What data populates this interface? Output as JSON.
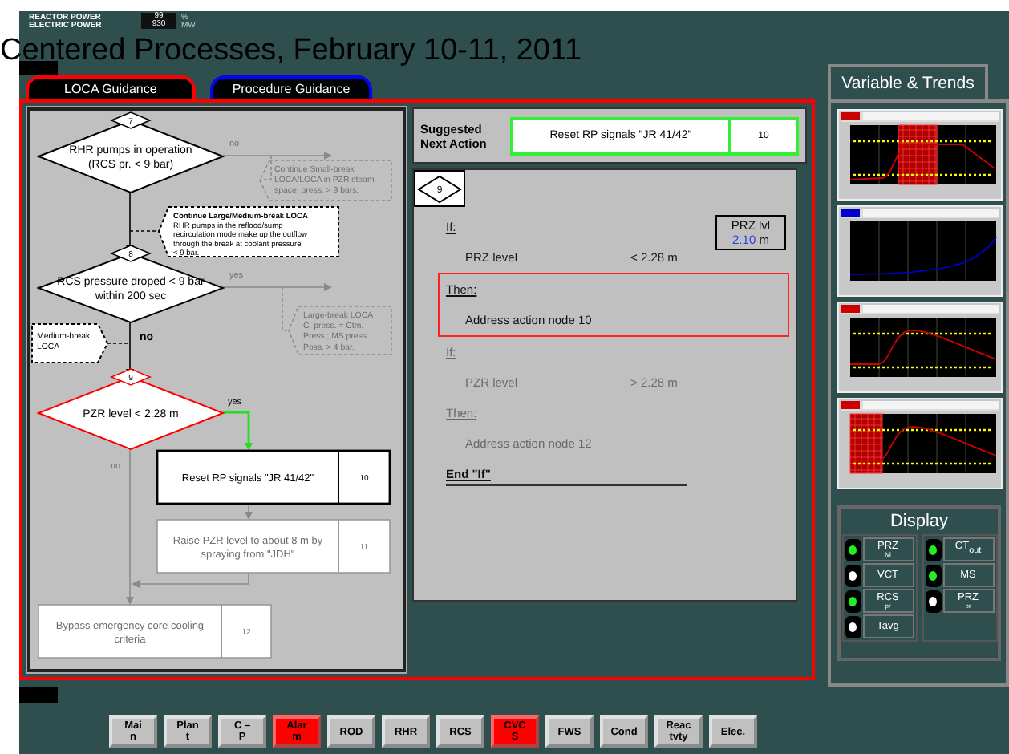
{
  "header": {
    "title": "Centered Processes, February 10-11, 2011",
    "readouts": [
      {
        "label": "REACTOR POWER",
        "value": "99",
        "unit": "%"
      },
      {
        "label": "ELECTRIC POWER",
        "value": "930",
        "unit": "MW"
      }
    ]
  },
  "tabs": [
    {
      "label": "LOCA Guidance",
      "color": "#ff0000",
      "selected": true
    },
    {
      "label": "Procedure Guidance",
      "color": "#0000ff",
      "selected": false
    }
  ],
  "flowchart": {
    "nodes": [
      {
        "kind": "decision",
        "number": "7",
        "highlighted": false,
        "dimmed": false,
        "lines": [
          "RHR pumps in operation",
          "(RCS pr. < 9 bar)"
        ]
      },
      {
        "kind": "note",
        "highlighted": false,
        "dimmed": true,
        "lines": [
          "Continue Small-break",
          "LOCA/LOCA in PZR steam",
          "space; press. > 9 bars."
        ]
      },
      {
        "kind": "note",
        "highlighted": false,
        "dimmed": false,
        "title": "Continue Large/Medium-break LOCA",
        "lines": [
          "RHR pumps in the reflood/sump",
          "recirculation mode make up the outflow",
          "through the break at coolant pressure",
          "< 9 bar."
        ]
      },
      {
        "kind": "decision",
        "number": "8",
        "highlighted": false,
        "dimmed": false,
        "lines": [
          "RCS pressure droped < 9 bar",
          "within 200 sec"
        ]
      },
      {
        "kind": "note",
        "highlighted": false,
        "dimmed": false,
        "lines": [
          "Medium-break",
          "LOCA"
        ]
      },
      {
        "kind": "note",
        "highlighted": false,
        "dimmed": true,
        "lines": [
          "Large-break LOCA",
          "C. press. = Ctm.",
          "Press.; MS press.",
          "Poss. > 4 bar."
        ]
      },
      {
        "kind": "decision",
        "number": "9",
        "highlighted": true,
        "dimmed": false,
        "lines": [
          "PZR level < 2.28 m"
        ]
      },
      {
        "kind": "action",
        "number": "10",
        "highlighted": true,
        "dimmed": false,
        "lines": [
          "Reset RP signals \"JR 41/42\""
        ]
      },
      {
        "kind": "action",
        "number": "11",
        "highlighted": false,
        "dimmed": true,
        "lines": [
          "Raise PZR level to about 8 m by",
          "spraying from \"JDH\""
        ]
      },
      {
        "kind": "action",
        "number": "12",
        "highlighted": false,
        "dimmed": true,
        "lines": [
          "Bypass emergency core cooling",
          "criteria"
        ]
      }
    ],
    "edges": [
      {
        "taken": false,
        "dimmed": true,
        "label": "no"
      },
      {
        "taken": false,
        "dimmed": false
      },
      {
        "taken": false,
        "dimmed": true,
        "label": "yes"
      },
      {
        "taken": false,
        "dimmed": false,
        "label": "no"
      },
      {
        "taken": true,
        "dimmed": false,
        "label": "yes"
      },
      {
        "taken": false,
        "dimmed": true,
        "label": "no"
      },
      {
        "taken": false,
        "dimmed": true
      },
      {
        "taken": false,
        "dimmed": true
      }
    ]
  },
  "suggestion": {
    "title": "Suggested Next Action",
    "action": "Reset RP signals \"JR 41/42\"",
    "number": "10"
  },
  "logic": {
    "node": "9",
    "reading": {
      "label": "PRZ lvl",
      "value": "2.10",
      "unit": "m"
    },
    "blocks": [
      {
        "kind": "if",
        "active": true,
        "label": "If:",
        "subject": "PRZ level",
        "condition": "< 2.28 m"
      },
      {
        "kind": "then",
        "active": true,
        "highlighted": true,
        "label": "Then:",
        "action": "Address action node 10"
      },
      {
        "kind": "if",
        "active": false,
        "label": "If:",
        "subject": "PZR level",
        "condition": "> 2.28 m"
      },
      {
        "kind": "then",
        "active": false,
        "highlighted": false,
        "label": "Then:",
        "action": "Address action node 12"
      }
    ],
    "end": "End \"If\""
  },
  "trends_tab": "Variable & Trends",
  "trends": [
    {
      "kind": "plateau",
      "color": "#cc0000",
      "limits": true,
      "alarm": true
    },
    {
      "kind": "rise",
      "color": "#0000cc",
      "limits": false,
      "alarm": false
    },
    {
      "kind": "peak",
      "color": "#cc0000",
      "limits": true,
      "alarm": false
    },
    {
      "kind": "peak",
      "color": "#cc0000",
      "limits": true,
      "alarm": true
    }
  ],
  "display": {
    "title": "Display",
    "columns": [
      [
        {
          "label": "PRZ",
          "sub": "lvl",
          "on": true
        },
        {
          "label": "VCT",
          "on": false
        },
        {
          "label": "RCS",
          "sub": "pr",
          "on": true
        },
        {
          "label": "Tavg",
          "on": false
        }
      ],
      [
        {
          "label": "CT$_{out}$",
          "on": true
        },
        {
          "label": "MS",
          "on": true
        },
        {
          "label": "PRZ",
          "sub": "pr",
          "on": false
        }
      ]
    ]
  },
  "nav_buttons": [
    {
      "lines": [
        "Mai",
        "n"
      ],
      "alarm": false
    },
    {
      "lines": [
        "Plan",
        "t"
      ],
      "alarm": false
    },
    {
      "lines": [
        "C –",
        "P"
      ],
      "alarm": false
    },
    {
      "lines": [
        "Alar",
        "m"
      ],
      "alarm": true
    },
    {
      "lines": [
        "ROD"
      ],
      "alarm": false
    },
    {
      "lines": [
        "RHR"
      ],
      "alarm": false
    },
    {
      "lines": [
        "RCS"
      ],
      "alarm": false
    },
    {
      "lines": [
        "CVC",
        "S"
      ],
      "alarm": true
    },
    {
      "lines": [
        "FWS"
      ],
      "alarm": false
    },
    {
      "lines": [
        "Cond"
      ],
      "alarm": false
    },
    {
      "lines": [
        "Reac",
        "tvty"
      ],
      "alarm": false
    },
    {
      "lines": [
        "Elec."
      ],
      "alarm": false
    }
  ]
}
